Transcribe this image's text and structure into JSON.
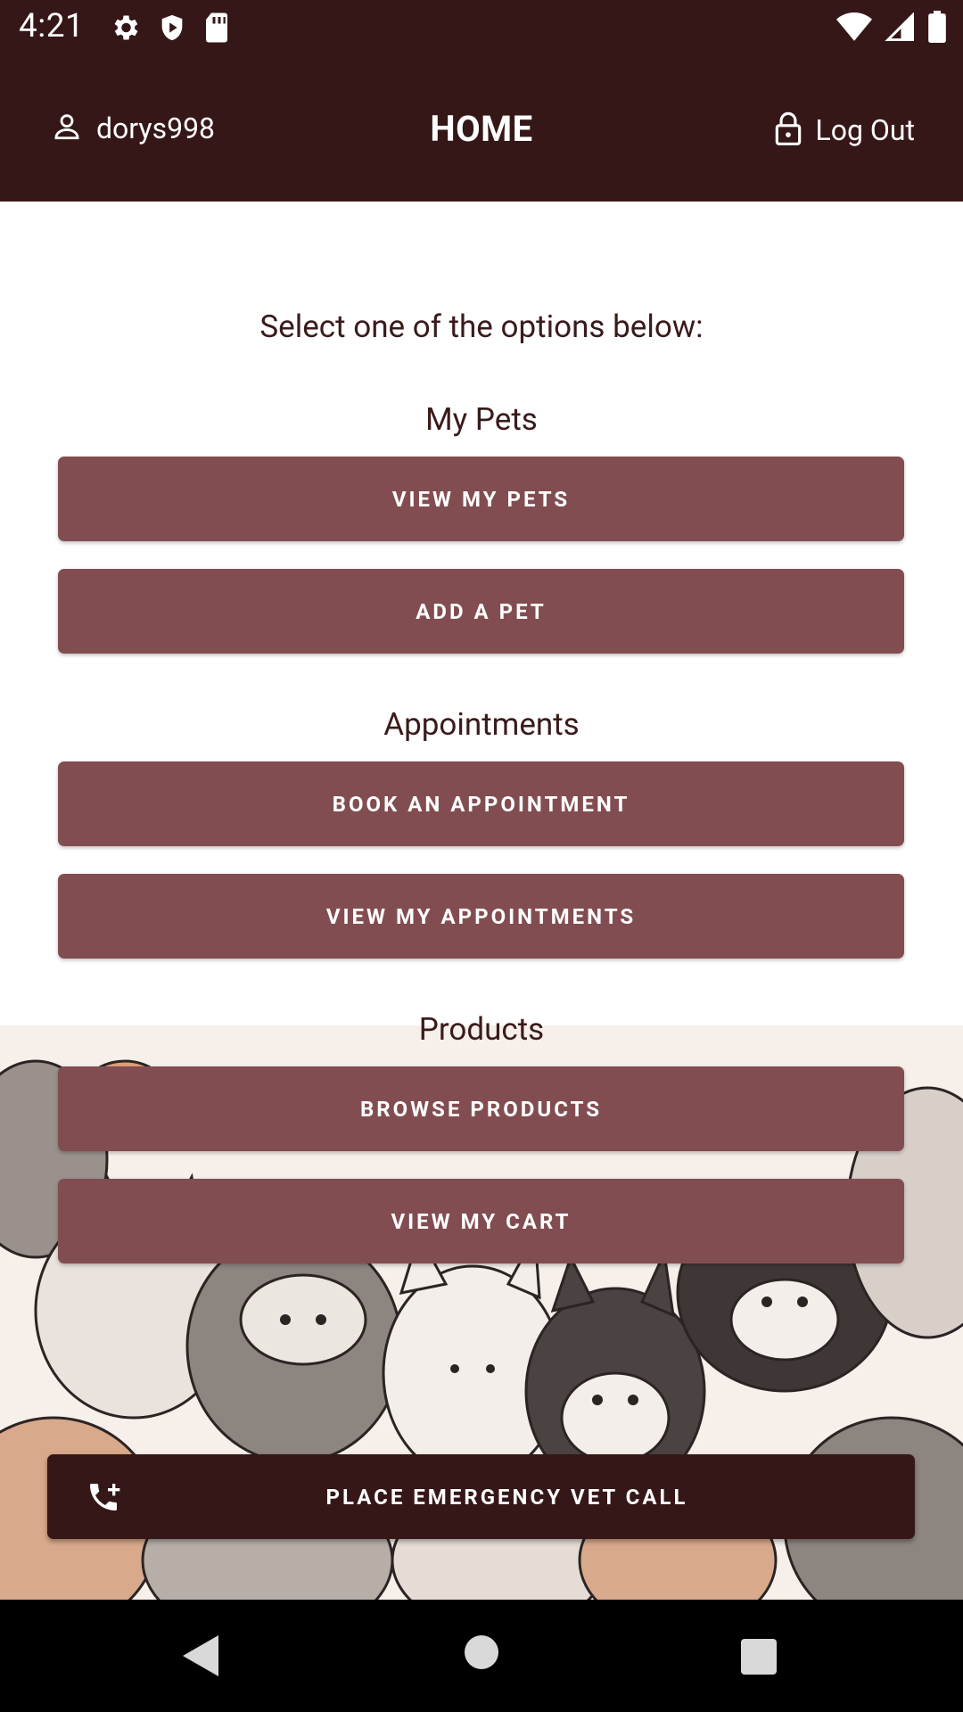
{
  "status_bar": {
    "time": "4:21",
    "left_icons": [
      "settings-icon",
      "shield-icon",
      "sd-card-icon"
    ],
    "right_icons": [
      "wifi-icon",
      "cell-signal-icon",
      "battery-icon"
    ]
  },
  "app_bar": {
    "username": "dorys998",
    "title": "HOME",
    "logout_label": "Log Out"
  },
  "content": {
    "prompt": "Select one of the options below:",
    "sections": [
      {
        "title": "My Pets",
        "buttons": [
          "VIEW MY PETS",
          "ADD A PET"
        ]
      },
      {
        "title": "Appointments",
        "buttons": [
          "BOOK AN APPOINTMENT",
          "VIEW MY APPOINTMENTS"
        ]
      },
      {
        "title": "Products",
        "buttons": [
          "BROWSE PRODUCTS",
          "VIEW MY CART"
        ]
      }
    ]
  },
  "emergency": {
    "label": "PLACE EMERGENCY VET CALL",
    "icon": "add-call-icon"
  },
  "nav_bar": {
    "icons": [
      "back-icon",
      "home-icon",
      "recents-icon"
    ]
  },
  "colors": {
    "app_bar": "#361717",
    "button": "#824d51",
    "text": "#3a1b1b"
  }
}
